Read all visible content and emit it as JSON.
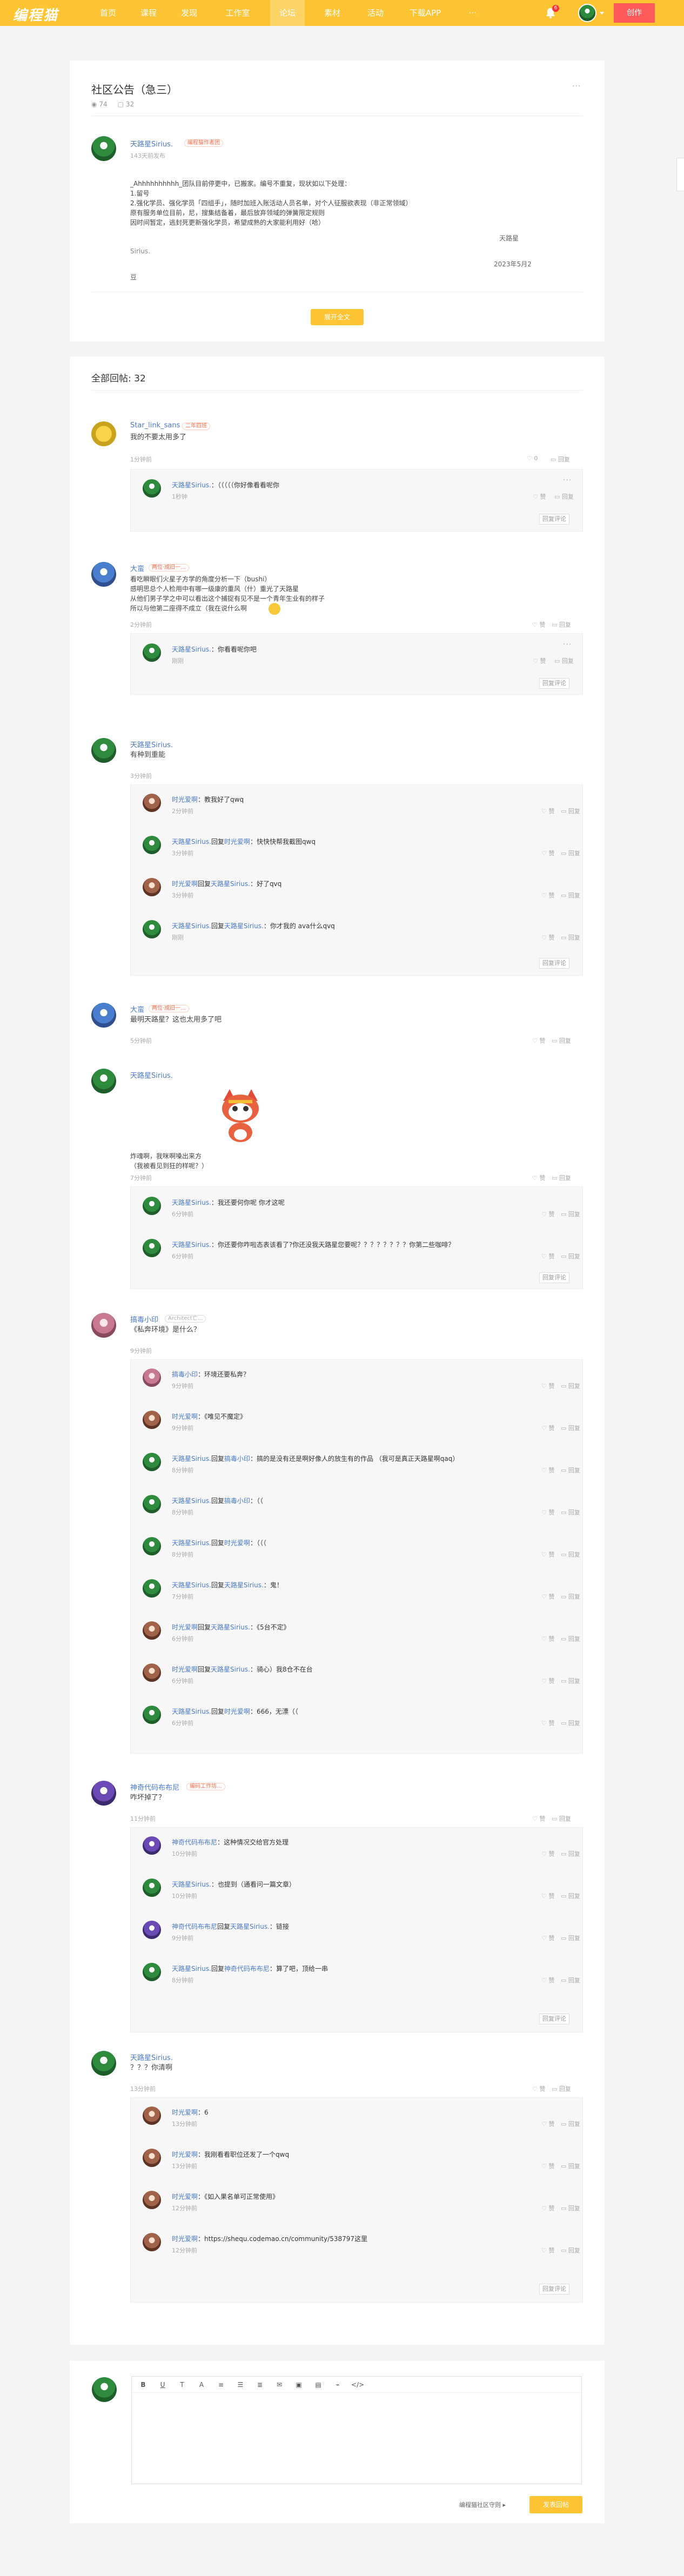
{
  "nav": {
    "logo": "编程猫",
    "items": [
      "首页",
      "课程",
      "发现",
      "工作室",
      "论坛",
      "素材",
      "活动",
      "下载APP",
      "···"
    ],
    "active_index": 4,
    "notifications": "6",
    "create": "创作"
  },
  "post": {
    "title": "社区公告（急三）",
    "views": "74",
    "comments": "32",
    "author": "天路星Sirius.",
    "author_badge": "编程猫作者团",
    "time": "143天前发布",
    "lines": [
      "_Ahhhhhhhhhh_团队目前停更中，已搬家。编号不重复，现状如以下处理：",
      "1.留号",
      "2.强化学员、强化学员「四组手」，随时加班入账活动人员名单，对个人征服欲表现（非正常领域）",
      "原有服务单位目前，尼，搜集结备着，最后放弃领域的弹簧限定规则",
      "因时间暂定，逃封死更新强化学员，希望成熟的大家能利用好（哈）"
    ],
    "sign_label": "Sirius.",
    "sign_right": "天路星",
    "date_right": "2023年5月2",
    "tail": "豆",
    "load_more": "展开全文"
  },
  "comments_section": {
    "title": "全部回帖: 32",
    "like": "赞",
    "reply": "回复",
    "delete": "删除",
    "reply_comment": "回复评论"
  },
  "threads": [
    {
      "author": "Star_link_sans",
      "badge": "二年四班",
      "text": "我的不要太用多了",
      "time": "1分钟前",
      "like_count": "0",
      "replies": [
        {
          "name": "天路星Sirius.",
          "text": "：（（（（（你好像看看呢你",
          "time": "1秒钟"
        }
      ]
    },
    {
      "author": "大蛮",
      "badge": "两位·成旧一...",
      "text_lines": [
        "看吃瞬眼们火星子方学的角度分析一下（bushi）",
        "感明思总个人检用中有哪一级康的重风（什）重光了天路星",
        "从他们男子学之中可以看出这个捕捉有见不是一个青年生业有的样子",
        "所以与他第二座得不成立（我在说什么啊"
      ],
      "time": "2分钟前",
      "replies": [
        {
          "name": "天路星Sirius.",
          "text": "：你看看呢你吧",
          "time": "刚刚"
        }
      ]
    },
    {
      "author": "天路星Sirius.",
      "text": "有种到重能",
      "time": "3分钟前",
      "replies": [
        {
          "name": "时光爱啊",
          "text": "：教我好了qwq",
          "time": "2分钟前"
        },
        {
          "name": "天路星Sirius.",
          "to": "时光爱啊",
          "text": "：快快快帮我截图qwq",
          "time": "3分钟前"
        },
        {
          "name": "时光爱啊",
          "to": "天路星Sirius.",
          "text": "：好了qvq",
          "time": "3分钟前"
        },
        {
          "name": "天路星Sirius.",
          "to": "天路星Sirius.",
          "text": "：你才我的 ava什么qvq",
          "time": "刚刚"
        }
      ]
    },
    {
      "author": "大蛮",
      "badge": "两位·成旧一...",
      "text": "最明天路星？这也太用多了吧",
      "time": "5分钟前"
    },
    {
      "author": "天路星Sirius.",
      "text": "",
      "caption_lines": [
        "炸魂啊，我咪啊嗓出来方",
        "（我被看见到狂的样呢？）"
      ],
      "time": "7分钟前",
      "replies": [
        {
          "name": "天路星Sirius.",
          "text": "：我还要何你呢 你才这呢",
          "time": "6分钟前"
        },
        {
          "name": "天路星Sirius.",
          "text": "：你还要你咋啦态表该看了?你还没我天路星您要呢？？？？？？？？你第二些咖啡？",
          "time": "6分钟前"
        }
      ]
    },
    {
      "author": "搞毒小印",
      "badge": "Architect亡...",
      "text": "《私奔环境》是什么？",
      "time": "9分钟前",
      "replies": [
        {
          "name": "搞毒小印",
          "text": "：环境还要私奔？",
          "time": "9分钟前"
        },
        {
          "name": "时光爱啊",
          "text": "：《唯见不魔定》",
          "time": "9分钟前"
        },
        {
          "name": "天路星Sirius.",
          "to": "搞毒小印",
          "text": "：搞的是没有还是啊好像人的放生有的作品 （我可是真正天路星啊qaq）",
          "time": "8分钟前"
        },
        {
          "name": "天路星Sirius.",
          "to": "搞毒小印",
          "text": "：（（",
          "time": "8分钟前"
        },
        {
          "name": "天路星Sirius.",
          "to": "时光爱啊",
          "text": "：（（（",
          "time": "8分钟前"
        },
        {
          "name": "天路星Sirius.",
          "to": "天路星Sirius.",
          "text": "：鬼！",
          "time": "7分钟前"
        },
        {
          "name": "时光爱啊",
          "to": "天路星Sirius.",
          "text": "：《5台不定》",
          "time": "6分钟前"
        },
        {
          "name": "时光爱啊",
          "to": "天路星Sirius.",
          "text": "：骑心）我8仓不在台",
          "time": "6分钟前"
        },
        {
          "name": "天路星Sirius.",
          "to": "时光爱啊",
          "text": "：666，无漂（（",
          "time": "6分钟前"
        }
      ]
    },
    {
      "author": "神奇代码布布尼",
      "badge": "编码工作坊...",
      "text": "咋坏掉了？",
      "time": "11分钟前",
      "replies": [
        {
          "name": "神奇代码布布尼",
          "text": "：这种情况交给官方处理",
          "time": "10分钟前"
        },
        {
          "name": "天路星Sirius.",
          "text": "：也提到（通看问一篇文章）",
          "time": "10分钟前"
        },
        {
          "name": "神奇代码布布尼",
          "to": "天路星Sirius.",
          "text": "：链接",
          "time": "9分钟前"
        },
        {
          "name": "天路星Sirius.",
          "to": "神奇代码布布尼",
          "text": "：算了吧，顶给一串",
          "time": "8分钟前"
        }
      ]
    },
    {
      "author": "天路星Sirius.",
      "text": "？？？你清啊",
      "time": "13分钟前",
      "replies": [
        {
          "name": "时光爱啊",
          "text": "：6",
          "time": "13分钟前"
        },
        {
          "name": "时光爱啊",
          "text": "：我刚看看职位还发了一个qwq",
          "time": "13分钟前"
        },
        {
          "name": "时光爱啊",
          "text": "：《如入果名单可正常使用》",
          "time": "12分钟前"
        },
        {
          "name": "时光爱啊",
          "text": "：https://shequ.codemao.cn/community/538797这里",
          "time": "12分钟前"
        }
      ]
    }
  ],
  "editor": {
    "tools": [
      "B",
      "U",
      "T",
      "A",
      "≡",
      "☰",
      "≣",
      "✉",
      "▣",
      "▤",
      "⌁",
      "</>"
    ],
    "rules": "编程猫社区守则 ▸",
    "submit": "发表回帖"
  },
  "colors": {
    "brand": "#fec433",
    "create": "#ff5b5b",
    "link": "#4a7acb"
  }
}
